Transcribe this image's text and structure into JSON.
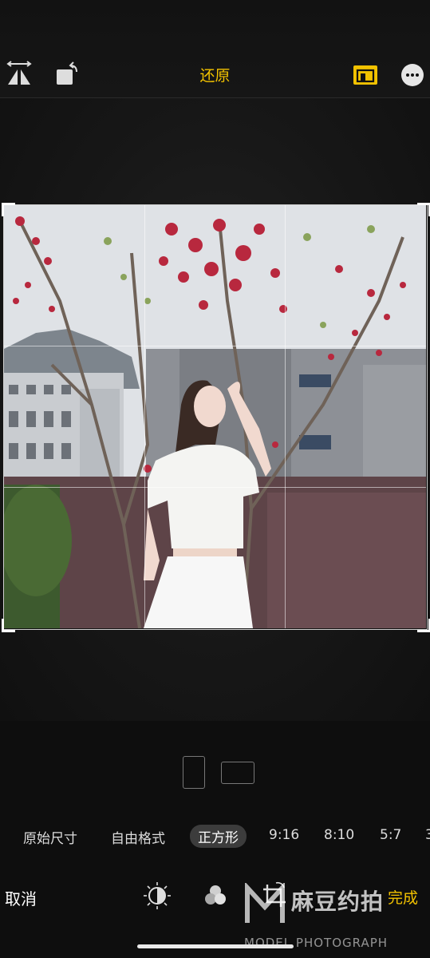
{
  "header": {
    "title": "还原",
    "icons": [
      "flip-icon",
      "rotate-icon",
      "aspect-ratio-icon",
      "more-icon"
    ]
  },
  "crop": {
    "ratios": [
      "原始尺寸",
      "自由格式",
      "正方形",
      "9:16",
      "8:10",
      "5:7",
      "3"
    ],
    "selected": "正方形",
    "orientation": [
      "portrait",
      "landscape"
    ]
  },
  "footer": {
    "cancel_label": "取消",
    "done_label": "完成",
    "tools": [
      "adjust-icon",
      "filters-icon",
      "crop-icon"
    ]
  },
  "watermark": {
    "text": "麻豆约拍",
    "subtext": "MODEL PHOTOGRAPH"
  },
  "colors": {
    "accent": "#f2c200",
    "background": "#0e0e0e"
  }
}
